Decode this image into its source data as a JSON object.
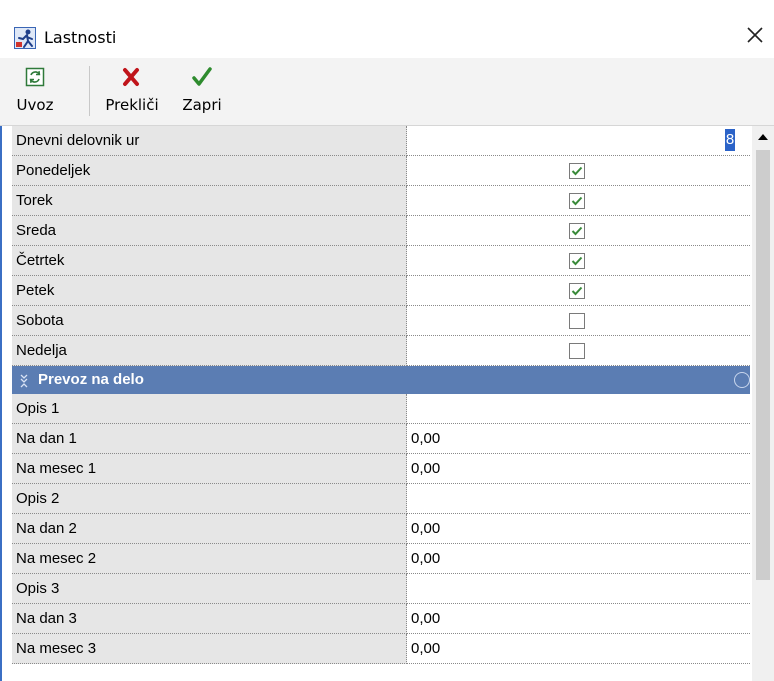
{
  "window": {
    "title": "Lastnosti",
    "app_icon": "properties-app-icon",
    "close_icon": "close-icon"
  },
  "toolbar": {
    "import_label": "Uvoz",
    "import_icon": "import-icon",
    "cancel_label": "Prekliči",
    "cancel_icon": "red-x-icon",
    "close_label": "Zapri",
    "close_icon": "green-check-icon"
  },
  "properties": {
    "hours": {
      "label": "Dnevni delovnik ur",
      "value": "8"
    },
    "days": [
      {
        "label": "Ponedeljek",
        "checked": true
      },
      {
        "label": "Torek",
        "checked": true
      },
      {
        "label": "Sreda",
        "checked": true
      },
      {
        "label": "Četrtek",
        "checked": true
      },
      {
        "label": "Petek",
        "checked": true
      },
      {
        "label": "Sobota",
        "checked": false
      },
      {
        "label": "Nedelja",
        "checked": false
      }
    ],
    "transport_section": {
      "title": "Prevoz na delo",
      "rows": [
        {
          "label": "Opis 1",
          "value": ""
        },
        {
          "label": "Na dan 1",
          "value": "0,00"
        },
        {
          "label": "Na mesec 1",
          "value": "0,00"
        },
        {
          "label": "Opis 2",
          "value": ""
        },
        {
          "label": "Na dan 2",
          "value": "0,00"
        },
        {
          "label": "Na mesec 2",
          "value": "0,00"
        },
        {
          "label": "Opis 3",
          "value": ""
        },
        {
          "label": "Na dan 3",
          "value": "0,00"
        },
        {
          "label": "Na mesec 3",
          "value": "0,00"
        }
      ]
    }
  },
  "colors": {
    "section_header": "#5b7db3",
    "label_cell": "#e6e6e6",
    "check_color": "#3a8a3a",
    "cancel_red": "#c0141a",
    "confirm_green": "#2e8b2e"
  }
}
